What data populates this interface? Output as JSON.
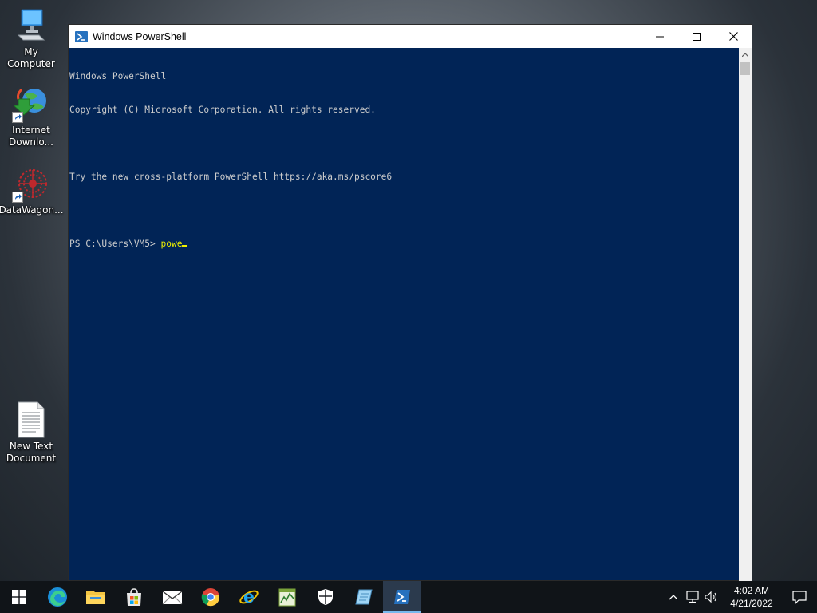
{
  "desktop": {
    "icons": [
      {
        "name": "my-computer",
        "label": "My Computer"
      },
      {
        "name": "internet-download",
        "label": "Internet\nDownlo..."
      },
      {
        "name": "datawagon",
        "label": "DataWagon..."
      },
      {
        "name": "new-text-document",
        "label": "New Text\nDocument"
      }
    ]
  },
  "window": {
    "title": "Windows PowerShell",
    "console_lines": [
      "Windows PowerShell",
      "Copyright (C) Microsoft Corporation. All rights reserved.",
      "",
      "Try the new cross-platform PowerShell https://aka.ms/pscore6",
      ""
    ],
    "prompt": "PS C:\\Users\\VM5> ",
    "typed_input": "powe",
    "colors": {
      "background": "#012456",
      "text": "#cccccc",
      "input": "#f0f000"
    }
  },
  "taskbar": {
    "apps": [
      {
        "name": "start-icon"
      },
      {
        "name": "edge-icon"
      },
      {
        "name": "file-explorer-icon"
      },
      {
        "name": "store-icon"
      },
      {
        "name": "mail-icon"
      },
      {
        "name": "chrome-icon"
      },
      {
        "name": "internet-explorer-icon"
      },
      {
        "name": "task-manager-icon"
      },
      {
        "name": "security-icon"
      },
      {
        "name": "notepad-icon"
      },
      {
        "name": "powershell-icon",
        "active": true
      }
    ],
    "clock": {
      "time": "4:02 AM",
      "date": "4/21/2022"
    }
  }
}
